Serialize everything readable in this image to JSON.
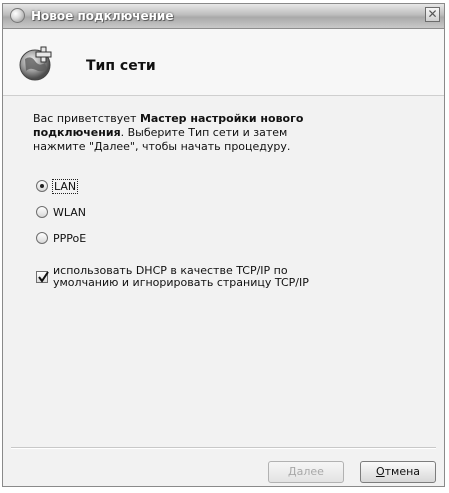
{
  "window": {
    "title": "Новое подключение",
    "close_glyph": "✕"
  },
  "header": {
    "title": "Тип сети",
    "icon": "network-plus-icon"
  },
  "intro": {
    "part1": "Вас приветствует ",
    "bold": "Мастер настройки нового подключения",
    "part2": ". Выберите Тип сети и затем нажмите \"Далее\", чтобы начать процедуру."
  },
  "network_types": {
    "selected": "LAN",
    "options": [
      "LAN",
      "WLAN",
      "PPPoE"
    ]
  },
  "dhcp_option": {
    "checked": true,
    "label": "использовать DHCP в качестве TCP/IP по умолчанию и игнорировать страницу TCP/IP"
  },
  "buttons": {
    "next": {
      "label": "Далее",
      "enabled": false
    },
    "cancel": {
      "mnemonic": "О",
      "rest": "тмена"
    }
  }
}
